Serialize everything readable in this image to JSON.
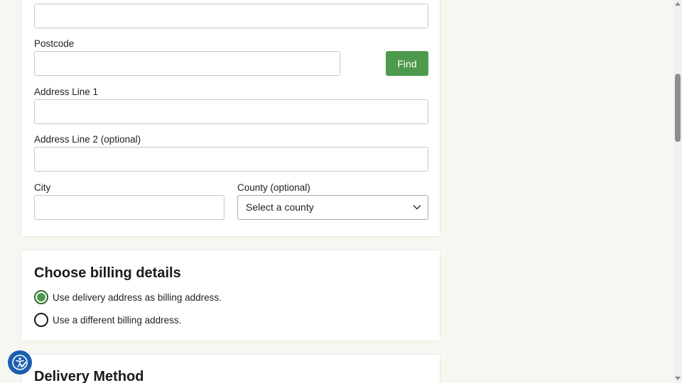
{
  "address_form": {
    "postcode_label": "Postcode",
    "find_label": "Find",
    "address_line1_label": "Address Line 1",
    "address_line2_label": "Address Line 2 (optional)",
    "city_label": "City",
    "county_label": "County (optional)",
    "county_selected": "Select a county"
  },
  "billing": {
    "title": "Choose billing details",
    "options": [
      {
        "label": "Use delivery address as billing address.",
        "checked": true
      },
      {
        "label": "Use a different billing address.",
        "checked": false
      }
    ]
  },
  "delivery": {
    "title": "Delivery Method"
  },
  "colors": {
    "accent_green": "#4d9a4d",
    "accessibility_blue": "#1a5fae",
    "page_background": "#f6f7f0"
  }
}
